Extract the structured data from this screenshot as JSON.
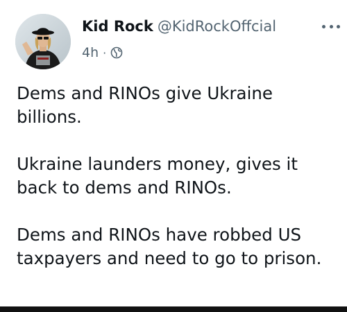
{
  "post": {
    "author": {
      "display_name": "Kid Rock",
      "handle": "@KidRockOffcial",
      "avatar_icon": "avatar-photo"
    },
    "time": "4h",
    "separator": "·",
    "visibility_icon": "globe-icon",
    "menu_icon": "more-options-icon",
    "paragraphs": [
      "Dems and RINOs give Ukraine billions.",
      "Ukraine launders money, gives it back to dems and RINOs.",
      "Dems and RINOs have robbed US taxpayers and need to go to prison."
    ]
  },
  "colors": {
    "text_primary": "#0f1419",
    "text_secondary": "#536471",
    "background": "#ffffff"
  }
}
